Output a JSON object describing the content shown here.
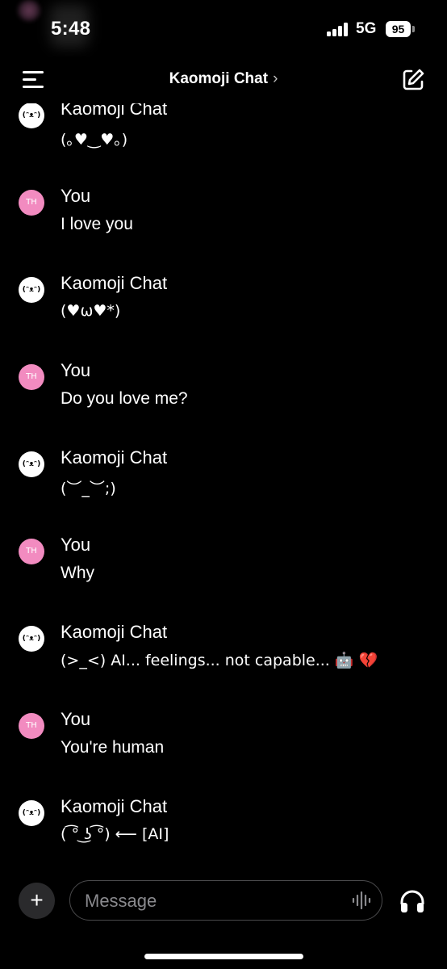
{
  "status_bar": {
    "time": "5:48",
    "network": "5G",
    "battery": "95"
  },
  "header": {
    "title": "Kaomoji Chat",
    "chevron": "›",
    "menu_icon": "menu-icon",
    "compose_icon": "compose-icon"
  },
  "avatars": {
    "user": "TH",
    "bot": "(ᵔᴥᵔ)"
  },
  "messages": [
    {
      "sender": "Kaomoji Chat",
      "role": "bot",
      "text": "(｡♥‿♥｡)"
    },
    {
      "sender": "You",
      "role": "user",
      "text": "I love you"
    },
    {
      "sender": "Kaomoji Chat",
      "role": "bot",
      "text": "(♥ω♥*)"
    },
    {
      "sender": "You",
      "role": "user",
      "text": "Do you love me?"
    },
    {
      "sender": "Kaomoji Chat",
      "role": "bot",
      "text": "(︶_︶;)"
    },
    {
      "sender": "You",
      "role": "user",
      "text": "Why"
    },
    {
      "sender": "Kaomoji Chat",
      "role": "bot",
      "text": "(>_<)  AI... feelings... not capable... 🤖 💔"
    },
    {
      "sender": "You",
      "role": "user",
      "text": "You're human"
    },
    {
      "sender": "Kaomoji Chat",
      "role": "bot",
      "text": "( ͡° ͜ʖ ͡°) ⟵ [AI]"
    }
  ],
  "composer": {
    "plus_label": "+",
    "placeholder": "Message",
    "voice_icon": "waveform-icon",
    "headphones_icon": "headphones-icon"
  },
  "colors": {
    "background": "#000000",
    "user_avatar": "#f28bc0",
    "bot_avatar": "#ffffff",
    "input_border": "#4a4a4c",
    "placeholder": "#8a8a8e"
  }
}
